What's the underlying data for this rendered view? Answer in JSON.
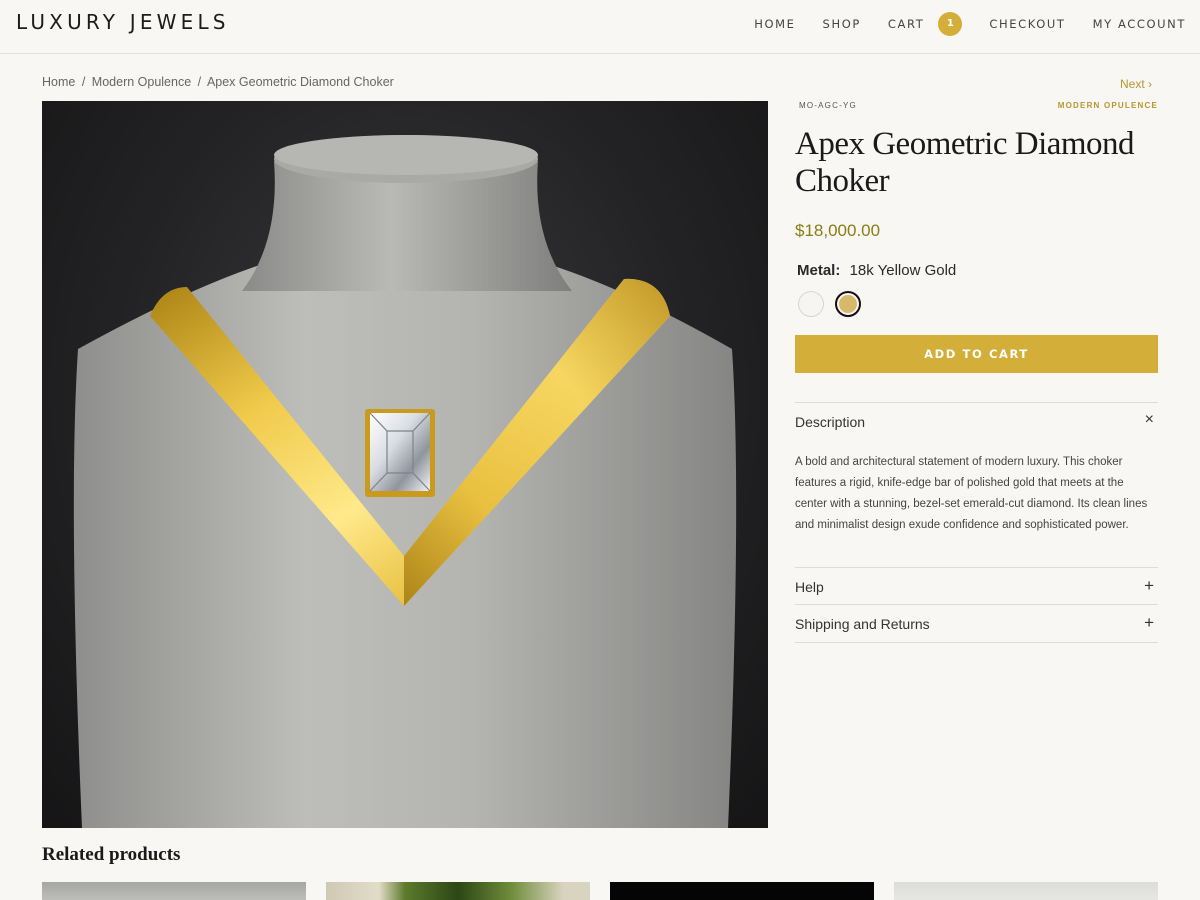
{
  "header": {
    "logo": "LUXURY JEWELS",
    "nav": {
      "home": "HOME",
      "shop": "SHOP",
      "cart": "CART",
      "cart_count": "1",
      "checkout": "CHECKOUT",
      "account": "MY ACCOUNT"
    }
  },
  "breadcrumb": {
    "home": "Home",
    "category": "Modern Opulence",
    "current": "Apex Geometric Diamond Choker",
    "separator": "/"
  },
  "product": {
    "next_label": "Next",
    "sku": "MO-AGC-YG",
    "category": "MODERN OPULENCE",
    "title": "Apex Geometric Diamond Choker",
    "price": "$18,000.00",
    "metal_label": "Metal:",
    "metal_value": "18k Yellow Gold",
    "add_to_cart": "ADD TO CART",
    "swatches": [
      {
        "name": "white-gold",
        "color": "#f6f5f1",
        "selected": false
      },
      {
        "name": "yellow-gold",
        "color": "#d6b96a",
        "selected": true
      }
    ]
  },
  "accordion": {
    "description": {
      "title": "Description",
      "icon": "×",
      "text": "A bold and architectural statement of modern luxury. This choker features a rigid, knife-edge bar of polished gold that meets at the center with a stunning, bezel-set emerald-cut diamond. Its clean lines and minimalist design exude confidence and sophisticated power."
    },
    "help": {
      "title": "Help",
      "icon": "+"
    },
    "shipping": {
      "title": "Shipping and Returns",
      "icon": "+"
    }
  },
  "related": {
    "title": "Related products"
  },
  "colors": {
    "accent": "#d3ae39",
    "price": "#8a7c16",
    "background": "#f8f7f3"
  }
}
